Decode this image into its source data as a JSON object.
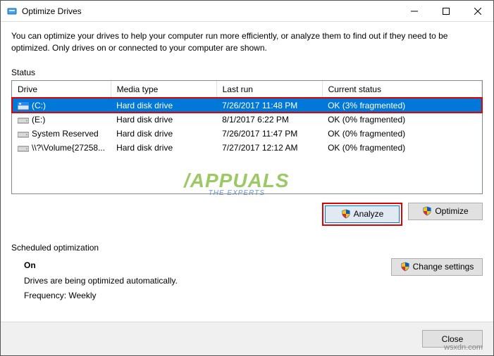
{
  "window": {
    "title": "Optimize Drives"
  },
  "intro": "You can optimize your drives to help your computer run more efficiently, or analyze them to find out if they need to be optimized. Only drives on or connected to your computer are shown.",
  "status": {
    "label": "Status",
    "columns": [
      "Drive",
      "Media type",
      "Last run",
      "Current status"
    ],
    "rows": [
      {
        "drive": "(C:)",
        "media": "Hard disk drive",
        "last_run": "7/26/2017 11:48 PM",
        "current": "OK (3% fragmented)",
        "selected": true,
        "highlighted": true,
        "icon": "os"
      },
      {
        "drive": "(E:)",
        "media": "Hard disk drive",
        "last_run": "8/1/2017 6:22 PM",
        "current": "OK (0% fragmented)",
        "selected": false,
        "highlighted": false,
        "icon": "hdd"
      },
      {
        "drive": "System Reserved",
        "media": "Hard disk drive",
        "last_run": "7/26/2017 11:47 PM",
        "current": "OK (0% fragmented)",
        "selected": false,
        "highlighted": false,
        "icon": "hdd"
      },
      {
        "drive": "\\\\?\\Volume{27258...",
        "media": "Hard disk drive",
        "last_run": "7/27/2017 12:12 AM",
        "current": "OK (0% fragmented)",
        "selected": false,
        "highlighted": false,
        "icon": "hdd"
      }
    ]
  },
  "buttons": {
    "analyze": "Analyze",
    "optimize": "Optimize",
    "change_settings": "Change settings",
    "close": "Close"
  },
  "schedule": {
    "label": "Scheduled optimization",
    "state": "On",
    "desc": "Drives are being optimized automatically.",
    "frequency": "Frequency: Weekly"
  },
  "watermark": "wsxdn.com"
}
